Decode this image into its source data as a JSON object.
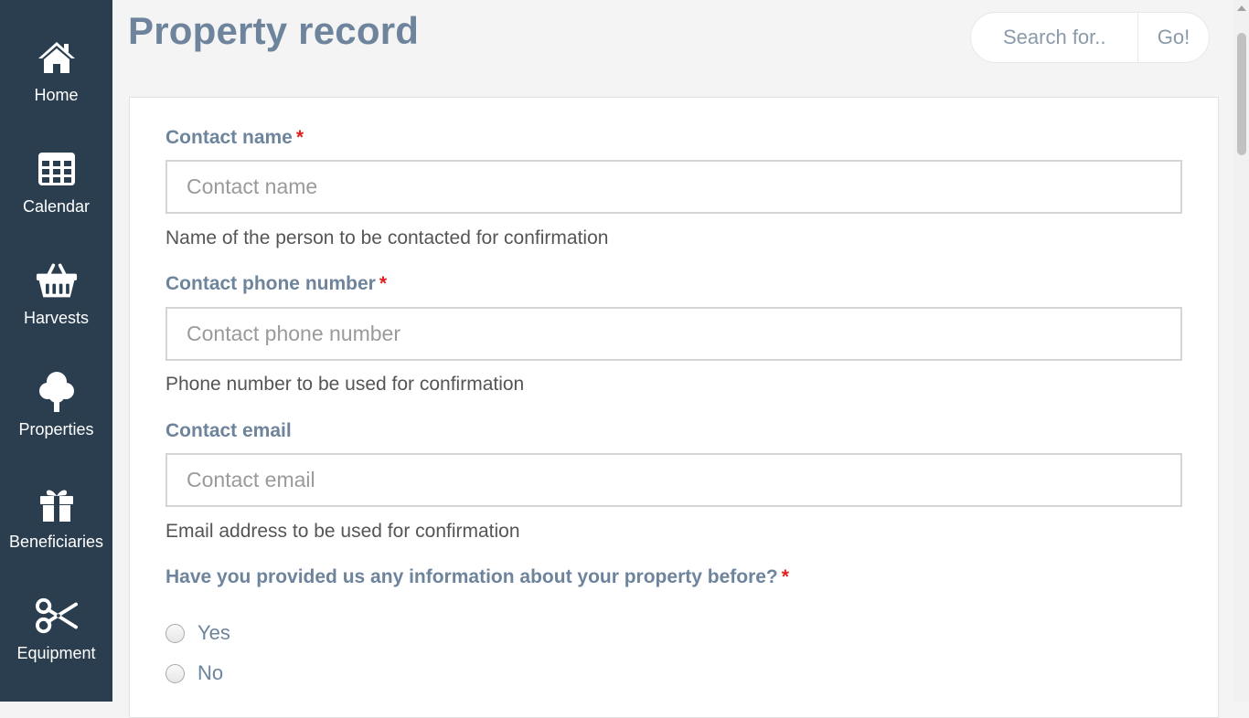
{
  "sidebar": {
    "items": [
      {
        "label": "Home",
        "icon": "home-icon"
      },
      {
        "label": "Calendar",
        "icon": "calendar-icon"
      },
      {
        "label": "Harvests",
        "icon": "basket-icon"
      },
      {
        "label": "Properties",
        "icon": "tree-icon"
      },
      {
        "label": "Beneficiaries",
        "icon": "gift-icon"
      },
      {
        "label": "Equipment",
        "icon": "scissors-icon"
      }
    ]
  },
  "header": {
    "title": "Property record"
  },
  "search": {
    "placeholder": "Search for..",
    "button_label": "Go!"
  },
  "form": {
    "contact_name": {
      "label": "Contact name",
      "required_mark": "*",
      "placeholder": "Contact name",
      "value": "",
      "help": "Name of the person to be contacted for confirmation"
    },
    "contact_phone": {
      "label": "Contact phone number",
      "required_mark": "*",
      "placeholder": "Contact phone number",
      "value": "",
      "help": "Phone number to be used for confirmation"
    },
    "contact_email": {
      "label": "Contact email",
      "placeholder": "Contact email",
      "value": "",
      "help": "Email address to be used for confirmation"
    },
    "provided_before": {
      "label": "Have you provided us any information about your property before?",
      "required_mark": "*",
      "options": [
        "Yes",
        "No"
      ]
    }
  },
  "colors": {
    "sidebar_bg": "#2b3e50",
    "accent_text": "#6d849c",
    "required": "#e02020"
  }
}
